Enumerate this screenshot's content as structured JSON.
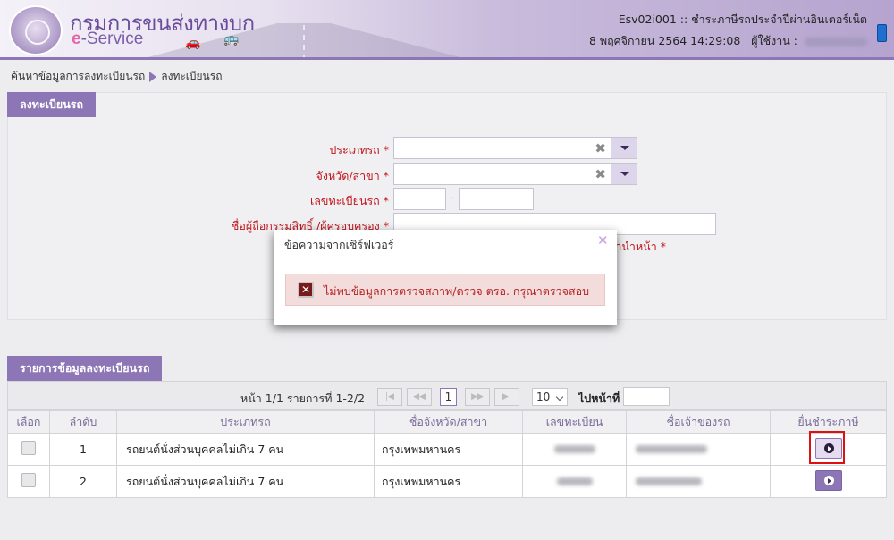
{
  "header": {
    "logo_title": "กรมการขนส่งทางบก",
    "logo_sub_prefix": "e",
    "logo_sub_rest": "-Service",
    "screen_code": "Esv02i001 :: ชำระภาษีรถประจำปีผ่านอินเตอร์เน็ต",
    "datetime": "8 พฤศจิกายน 2564 14:29:08",
    "user_label": "ผู้ใช้งาน :"
  },
  "breadcrumb": {
    "item1": "ค้นหาข้อมูลการลงทะเบียนรถ",
    "item2": "ลงทะเบียนรถ"
  },
  "form": {
    "section_title": "ลงทะเบียนรถ",
    "vehicle_type_label": "ประเภทรถ",
    "province_label": "จังหวัด/สาขา",
    "plate_label": "เลขทะเบียนรถ",
    "owner_label": "ชื่อผู้ถือกรรมสิทธิ์ /ผู้ครอบครอง",
    "prefix_label": "คำนำหน้า",
    "required_mark": "*",
    "plate_separator": "-",
    "clear_glyph": "✖"
  },
  "modal": {
    "title": "ข้อความจากเซิร์ฟเวอร์",
    "message": "ไม่พบข้อมูลการตรวจสภาพ/ตรวจ ตรอ. กรุณาตรวจสอบ",
    "close_glyph": "✕",
    "error_glyph": "✕"
  },
  "list": {
    "section_title": "รายการข้อมูลลงทะเบียนรถ",
    "pager_info": "หน้า 1/1 รายการที่ 1-2/2",
    "current_page": "1",
    "page_size": "10",
    "goto_label": "ไปหน้าที่",
    "columns": [
      "เลือก",
      "ลำดับ",
      "ประเภทรถ",
      "ชื่อจังหวัด/สาขา",
      "เลขทะเบียน",
      "ชื่อเจ้าของรถ",
      "ยื่นชำระภาษี"
    ],
    "rows": [
      {
        "seq": "1",
        "vehicle_type": "รถยนต์นั่งส่วนบุคคลไม่เกิน 7 คน",
        "province": "กรุงเทพมหานคร"
      },
      {
        "seq": "2",
        "vehicle_type": "รถยนต์นั่งส่วนบุคคลไม่เกิน 7 คน",
        "province": "กรุงเทพมหานคร"
      }
    ]
  },
  "icons": {
    "pager_first": "first-page-icon",
    "pager_prev": "prev-page-icon",
    "pager_next": "next-page-icon",
    "pager_last": "last-page-icon",
    "tax_submit": "play-circle-icon"
  },
  "colors": {
    "accent": "#8d76b6",
    "required": "#c0141c",
    "error_bg": "#f3dcdc",
    "highlight": "#e01010"
  }
}
